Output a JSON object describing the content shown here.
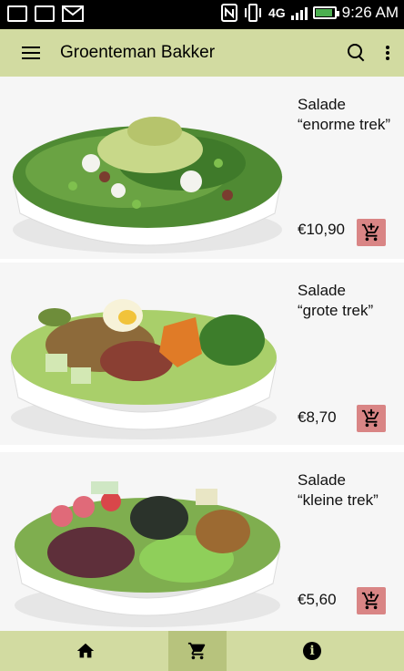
{
  "status_bar": {
    "time": "9:26 AM",
    "network": "4G",
    "icons": [
      "photo-notification-icon",
      "keyboard-notification-icon",
      "gmail-icon",
      "nfc-icon",
      "vibrate-icon",
      "signal-icon",
      "battery-icon"
    ]
  },
  "app_bar": {
    "title": "Groenteman Bakker",
    "icons": [
      "menu-icon",
      "search-icon",
      "more-vert-icon"
    ]
  },
  "products": [
    {
      "name_line1": "Salade",
      "name_line2": "“enorme trek”",
      "price": "€10,90",
      "cart_icon": "add-shopping-cart-icon"
    },
    {
      "name_line1": "Salade",
      "name_line2": "“grote trek”",
      "price": "€8,70",
      "cart_icon": "add-shopping-cart-icon"
    },
    {
      "name_line1": "Salade",
      "name_line2": "“kleine trek”",
      "price": "€5,60",
      "cart_icon": "add-shopping-cart-icon"
    }
  ],
  "bottom_nav": {
    "items": [
      {
        "icon": "home-icon",
        "active": false
      },
      {
        "icon": "shopping-cart-icon",
        "active": true
      },
      {
        "icon": "info-icon",
        "active": false
      }
    ]
  },
  "colors": {
    "app_bar": "#d2dba1",
    "bottom_nav": "#d2dba1",
    "nav_active": "#b7c37d",
    "cart_button": "#d98585"
  }
}
